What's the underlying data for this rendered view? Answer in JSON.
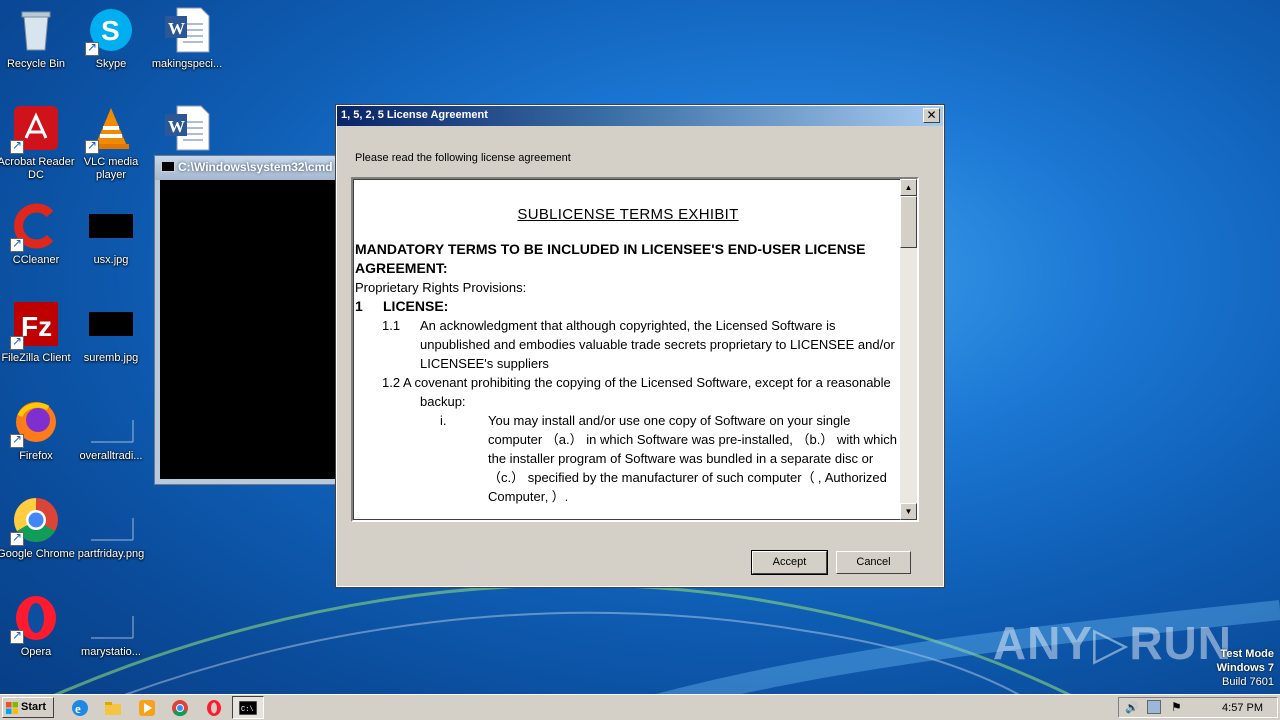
{
  "desktop": {
    "icons": [
      {
        "label": "Recycle Bin",
        "icon": "recycle-bin-icon"
      },
      {
        "label": "Skype",
        "icon": "skype-icon"
      },
      {
        "label": "makingspeci...",
        "icon": "word-document-icon"
      },
      {
        "label": "Acrobat Reader DC",
        "icon": "acrobat-icon"
      },
      {
        "label": "VLC media player",
        "icon": "vlc-icon"
      },
      {
        "label": "",
        "icon": "word-document-icon"
      },
      {
        "label": "CCleaner",
        "icon": "ccleaner-icon"
      },
      {
        "label": "usx.jpg",
        "icon": "image-file-icon"
      },
      {
        "label": "FileZilla Client",
        "icon": "filezilla-icon"
      },
      {
        "label": "suremb.jpg",
        "icon": "image-file-icon"
      },
      {
        "label": "Firefox",
        "icon": "firefox-icon"
      },
      {
        "label": "overalltradi...",
        "icon": "blank-file-icon"
      },
      {
        "label": "Google Chrome",
        "icon": "chrome-icon"
      },
      {
        "label": "partfriday.png",
        "icon": "blank-file-icon"
      },
      {
        "label": "Opera",
        "icon": "opera-icon"
      },
      {
        "label": "marystatio...",
        "icon": "blank-file-icon"
      }
    ]
  },
  "cmd_window": {
    "title": "C:\\Windows\\system32\\cmd"
  },
  "dialog": {
    "title": "1, 5, 2, 5 License Agreement",
    "close_label": "✕",
    "prompt": "Please read the following license agreement",
    "license": {
      "heading": "SUBLICENSE TERMS EXHIBIT",
      "mandatory": "MANDATORY TERMS TO BE INCLUDED IN LICENSEE'S END-USER LICENSE AGREEMENT:",
      "provisions": "Proprietary Rights Provisions:",
      "section1_num": "1",
      "section1_title": "LICENSE:",
      "item_1_1_num": "1.1",
      "item_1_1_text": "An acknowledgment that although copyrighted, the Licensed Software is unpublished and embodies valuable trade secrets proprietary to LICENSEE and/or LICENSEE's suppliers",
      "item_1_2_text": "1.2 A covenant prohibiting the copying of the Licensed Software, except for a reasonable backup:",
      "sub_i_num": "i.",
      "sub_i_text": "You may install and/or use one copy of Software on your single computer （a.） in which Software was pre-installed, （b.） with which the installer program of Software was bundled in a separate disc or （c.） specified by the manufacturer of such computer（ ‚ Authorized Computer‚ ）."
    },
    "accept_label": "Accept",
    "cancel_label": "Cancel"
  },
  "watermark": {
    "text": "ANY▷RUN",
    "test_mode": "Test Mode",
    "os": "Windows 7",
    "build": "Build 7601"
  },
  "taskbar": {
    "start_label": "Start",
    "clock": "4:57 PM"
  },
  "colors": {
    "dialog_title_start": "#0a246a",
    "dialog_title_end": "#a6caf0",
    "desktop_blue": "#1c78d4"
  }
}
